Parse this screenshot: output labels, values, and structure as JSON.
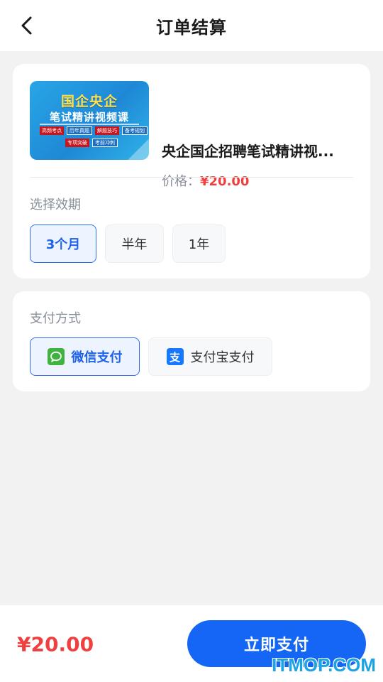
{
  "header": {
    "title": "订单结算",
    "back_icon": "chevron-left-icon"
  },
  "product": {
    "thumbnail": {
      "title": "国企央企",
      "subtitle": "笔试精讲视频课",
      "tags_row1": [
        "高频考点",
        "历年真题",
        "解题技巧",
        "备考规划"
      ],
      "tags_row2": [
        "专项突破",
        "考前冲刺"
      ],
      "colors": {
        "bg": "#1f88d6",
        "title": "#ffe14d",
        "tag": "#c7161d"
      }
    },
    "name": "央企国企招聘笔试精讲视...",
    "price_label": "价格：",
    "price": "¥20.00"
  },
  "validity": {
    "label": "选择效期",
    "options": [
      {
        "label": "3个月",
        "selected": true
      },
      {
        "label": "半年",
        "selected": false
      },
      {
        "label": "1年",
        "selected": false
      }
    ]
  },
  "payment": {
    "label": "支付方式",
    "options": [
      {
        "label": "微信支付",
        "icon": "wechat-icon",
        "selected": true
      },
      {
        "label": "支付宝支付",
        "icon": "alipay-icon",
        "icon_text": "支",
        "selected": false
      }
    ]
  },
  "footer": {
    "total": "¥20.00",
    "pay_button": "立即支付"
  },
  "watermark": "ITMOP.COM",
  "colors": {
    "accent": "#1566f5",
    "price": "#ef4040",
    "background": "#f2f2f2"
  }
}
